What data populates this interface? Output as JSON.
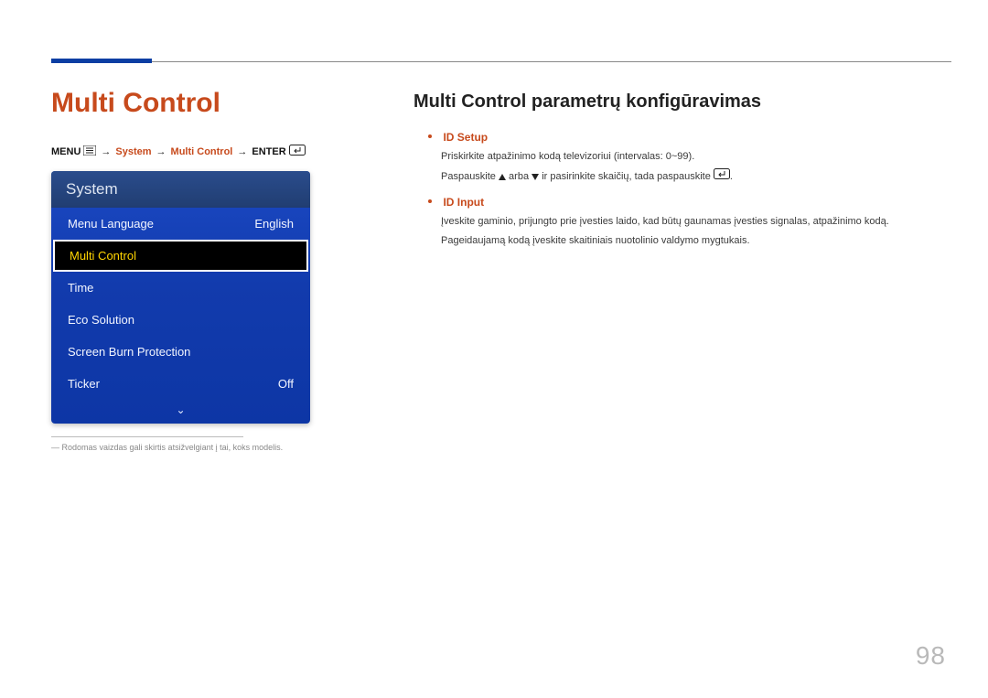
{
  "page": {
    "number": "98"
  },
  "left": {
    "heading": "Multi Control",
    "breadcrumb": {
      "menu": "MENU",
      "step1": "System",
      "step2": "Multi Control",
      "enter": "ENTER"
    },
    "osd": {
      "title": "System",
      "rows": [
        {
          "label": "Menu Language",
          "value": "English",
          "selected": false
        },
        {
          "label": "Multi Control",
          "value": "",
          "selected": true
        },
        {
          "label": "Time",
          "value": "",
          "selected": false
        },
        {
          "label": "Eco Solution",
          "value": "",
          "selected": false
        },
        {
          "label": "Screen Burn Protection",
          "value": "",
          "selected": false
        },
        {
          "label": "Ticker",
          "value": "Off",
          "selected": false
        }
      ],
      "scroll_glyph": "⌄"
    },
    "footnote": "Rodomas vaizdas gali skirtis atsižvelgiant į tai, koks modelis.",
    "footnote_mark": "―"
  },
  "right": {
    "heading": "Multi Control parametrų konfigūravimas",
    "items": [
      {
        "title": "ID Setup",
        "body1": "Priskirkite atpažinimo kodą televizoriui (intervalas: 0~99).",
        "body2_pre": "Paspauskite ",
        "body2_mid": " arba ",
        "body2_post": " ir pasirinkite skaičių, tada paspauskite ",
        "body2_end": "."
      },
      {
        "title": "ID Input",
        "body1": "Įveskite gaminio, prijungto prie įvesties laido, kad būtų gaunamas įvesties signalas, atpažinimo kodą.",
        "body2": "Pageidaujamą kodą įveskite skaitiniais nuotolinio valdymo mygtukais."
      }
    ]
  }
}
